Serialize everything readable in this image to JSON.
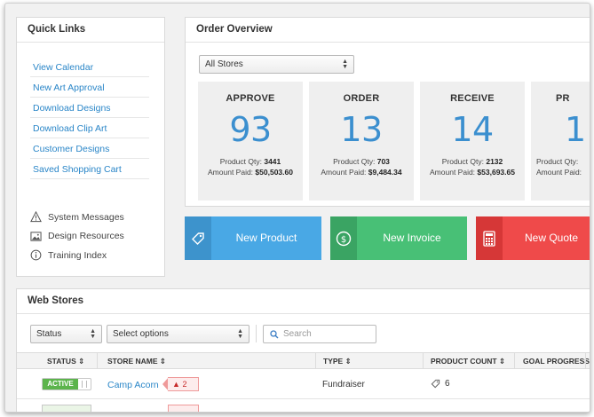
{
  "quick_links": {
    "title": "Quick Links",
    "links": [
      "View Calendar",
      "New Art Approval",
      "Download Designs",
      "Download Clip Art",
      "Customer Designs",
      "Saved Shopping Cart"
    ],
    "tools": [
      {
        "label": "System Messages",
        "icon": "warning-icon"
      },
      {
        "label": "Design Resources",
        "icon": "image-icon"
      },
      {
        "label": "Training Index",
        "icon": "info-icon"
      }
    ]
  },
  "order_overview": {
    "title": "Order Overview",
    "store_filter": "All Stores",
    "stats": [
      {
        "title": "APPROVE",
        "value": "93",
        "qty_label": "Product Qty:",
        "qty": "3441",
        "paid_label": "Amount Paid:",
        "paid": "$50,503.60"
      },
      {
        "title": "ORDER",
        "value": "13",
        "qty_label": "Product Qty:",
        "qty": "703",
        "paid_label": "Amount Paid:",
        "paid": "$9,484.34"
      },
      {
        "title": "RECEIVE",
        "value": "14",
        "qty_label": "Product Qty:",
        "qty": "2132",
        "paid_label": "Amount Paid:",
        "paid": "$53,693.65"
      },
      {
        "title": "PR",
        "value": "1",
        "qty_label": "Product Qty:",
        "qty": "",
        "paid_label": "Amount Paid:",
        "paid": ""
      }
    ]
  },
  "actions": {
    "new_product": "New Product",
    "new_invoice": "New Invoice",
    "new_quote": "New Quote"
  },
  "web_stores": {
    "title": "Web Stores",
    "status_filter": "Status",
    "options_filter": "Select options",
    "search_placeholder": "Search",
    "columns": [
      "STATUS",
      "STORE NAME",
      "TYPE",
      "PRODUCT COUNT",
      "GOAL PROGRESS"
    ],
    "rows": [
      {
        "status": "ACTIVE",
        "store_name": "Camp Acorn",
        "alert_count": "2",
        "type": "Fundraiser",
        "product_count": "6"
      }
    ]
  },
  "colors": {
    "link": "#2a86c8",
    "stat_number": "#3b8fcf",
    "new_product": "#49a8e5",
    "new_invoice": "#48c076",
    "new_quote": "#ef4a4a",
    "active": "#5cb44c"
  }
}
